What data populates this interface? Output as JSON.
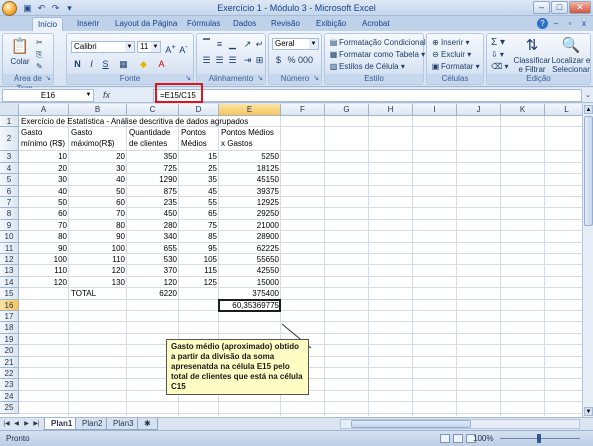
{
  "window": {
    "title": "Exercício 1 - Módulo 3 - Microsoft Excel",
    "minimize": "–",
    "maximize": "□",
    "close": "✕"
  },
  "ribbon_tabs": [
    "Início",
    "Inserir",
    "Layout da Página",
    "Fórmulas",
    "Dados",
    "Revisão",
    "Exibição",
    "Acrobat"
  ],
  "ribbon": {
    "clipboard": {
      "name": "Área de Tran...",
      "paste": "Colar"
    },
    "font": {
      "name": "Fonte",
      "family": "Calibri",
      "size": "11"
    },
    "alignment": {
      "name": "Alinhamento"
    },
    "number": {
      "name": "Número",
      "format": "Geral"
    },
    "styles": {
      "name": "Estilo",
      "conditional": "Formatação Condicional",
      "table": "Formatar como Tabela",
      "cell": "Estilos de Célula"
    },
    "cells": {
      "name": "Células",
      "insert": "Inserir",
      "delete": "Excluir",
      "format": "Formatar"
    },
    "editing": {
      "name": "Edição",
      "sort": "Classificar e Filtrar",
      "find": "Localizar e Selecionar"
    }
  },
  "formula_bar": {
    "name_box": "E16",
    "fx": "fx",
    "formula": "=E15/C15"
  },
  "columns": [
    "A",
    "B",
    "C",
    "D",
    "E",
    "F",
    "G",
    "H",
    "I",
    "J",
    "K",
    "L"
  ],
  "rows": [
    "1",
    "2",
    "3",
    "4",
    "5",
    "6",
    "7",
    "8",
    "9",
    "10",
    "11",
    "12",
    "13",
    "14",
    "15",
    "16",
    "17",
    "18",
    "19",
    "20",
    "21",
    "22",
    "23",
    "24",
    "25"
  ],
  "sheet": {
    "title_row": "Exercício de Estatística - Análise descritiva de dados agrupados",
    "headers": {
      "a": [
        "Gasto",
        "mínimo (R$)"
      ],
      "b": [
        "Gasto",
        "máximo(R$)"
      ],
      "c": [
        "Quantidade",
        "de clientes"
      ],
      "d": [
        "Pontos",
        "Médios"
      ],
      "e": [
        "Pontos Médios",
        "x Gastos"
      ]
    },
    "data": [
      [
        "10",
        "20",
        "350",
        "15",
        "5250"
      ],
      [
        "20",
        "30",
        "725",
        "25",
        "18125"
      ],
      [
        "30",
        "40",
        "1290",
        "35",
        "45150"
      ],
      [
        "40",
        "50",
        "875",
        "45",
        "39375"
      ],
      [
        "50",
        "60",
        "235",
        "55",
        "12925"
      ],
      [
        "60",
        "70",
        "450",
        "65",
        "29250"
      ],
      [
        "70",
        "80",
        "280",
        "75",
        "21000"
      ],
      [
        "80",
        "90",
        "340",
        "85",
        "28900"
      ],
      [
        "90",
        "100",
        "655",
        "95",
        "62225"
      ],
      [
        "100",
        "110",
        "530",
        "105",
        "55650"
      ],
      [
        "110",
        "120",
        "370",
        "115",
        "42550"
      ],
      [
        "120",
        "130",
        "120",
        "125",
        "15000"
      ]
    ],
    "total_label": "TOTAL",
    "total_clients": "6220",
    "total_product": "375400",
    "result": "60,35369775"
  },
  "callout": "Gasto médio (aproximado) obtido a partir da divisão da soma apresenatda na célula E15 pelo total de clientes que está na célula C15",
  "sheet_tabs": [
    "Plan1",
    "Plan2",
    "Plan3"
  ],
  "status": "Pronto",
  "zoom": "100%",
  "colors": {
    "accent": "#15428b",
    "highlight": "#e0141e",
    "callout_bg": "#fdfdc4"
  }
}
